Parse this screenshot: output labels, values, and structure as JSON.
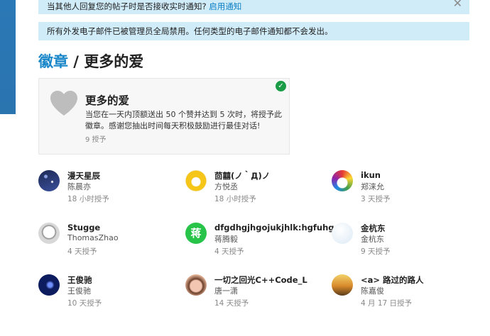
{
  "notices": {
    "reply_notify_text": "当其他人回复您的帖子时是否接收实时通知?",
    "reply_notify_link": "启用通知",
    "close_symbol": "✕",
    "email_disabled_text": "所有外发电子邮件已被管理员全局禁用。任何类型的电子邮件通知都不会发出。"
  },
  "header": {
    "crumb": "徽章",
    "separator": " / ",
    "title": "更多的爱"
  },
  "badge": {
    "name": "更多的爱",
    "description": "当您在一天内顶额送出 50 个赞并达到 5 次时，将授予此徽章。感谢您抽出时间每天积极鼓励进行最佳对话!",
    "count": "9 授予",
    "check_symbol": "✓",
    "icon": "heart-icon",
    "icon_color": "#bdbdbd",
    "check_color": "#1a9b45"
  },
  "users": [
    {
      "username": "漫天星辰",
      "name": "陈晨亦",
      "time": "18 小时授予",
      "avatar": "starry-night",
      "color": "#1d2a55"
    },
    {
      "username": "茴囍(ノ｀Д)ノ",
      "name": "方悦丞",
      "time": "18 小时授予",
      "avatar": "cartoon-duck",
      "color": "#f5c518"
    },
    {
      "username": "ikun",
      "name": "郑涞允",
      "time": "3 天授予",
      "avatar": "penguin-rainbow",
      "color": "#222222"
    },
    {
      "username": "Stugge",
      "name": "ThomasZhao",
      "time": "4 天授予",
      "avatar": "cartoon-character",
      "color": "#d8d8d8"
    },
    {
      "username": "dfgdhgjhgojukjhlk:hgfuhgu",
      "name": "蒋腾毅",
      "time": "4 天授予",
      "avatar": "letter-avatar",
      "avatar_letter": "蒋",
      "color": "#27c449"
    },
    {
      "username": "金杭东",
      "name": "金杭东",
      "time": "9 天授予",
      "avatar": "pale-blue",
      "color": "#dce9f5"
    },
    {
      "username": "王俊驰",
      "name": "王俊驰",
      "time": "10 天授予",
      "avatar": "dark-blue-abstract",
      "color": "#0d1c5e"
    },
    {
      "username": "一切之回光C++Code_L",
      "name": "唐一潇",
      "time": "14 天授予",
      "avatar": "anime-girl",
      "color": "#f2c6b0"
    },
    {
      "username": "<a> 路过的路人",
      "name": "陈嘉俊",
      "time": "4 月 17 日授予",
      "avatar": "autumn-trees",
      "color": "#d88a2a"
    }
  ]
}
